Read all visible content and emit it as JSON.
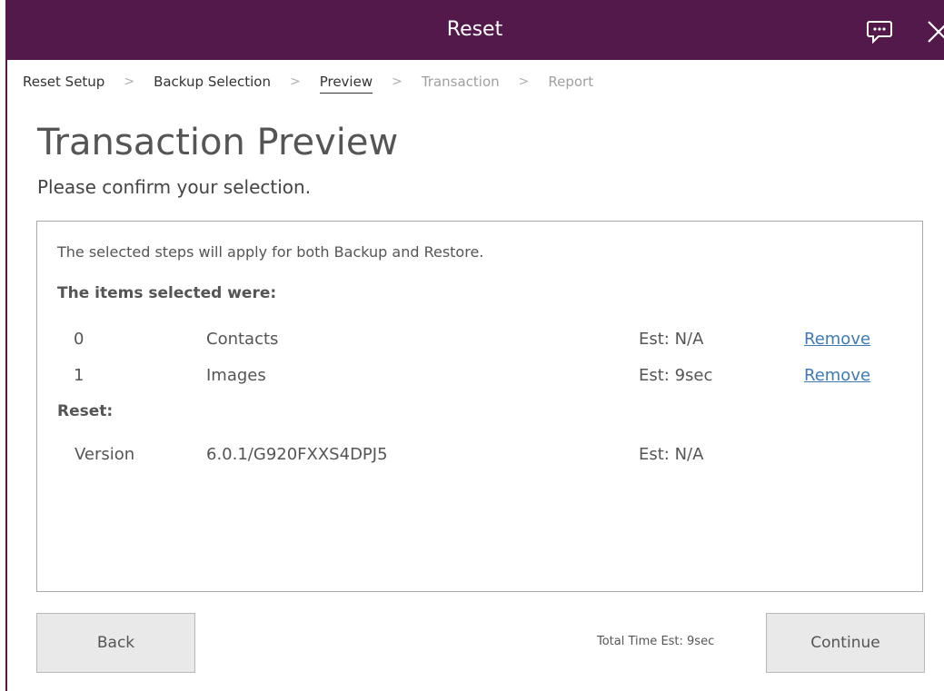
{
  "window": {
    "title": "Reset",
    "chat_icon": "chat-bubble-icon",
    "close_icon": "close-icon",
    "accent_color": "#52194a"
  },
  "breadcrumb": {
    "items": [
      {
        "label": "Reset Setup",
        "state": "completed"
      },
      {
        "label": "Backup Selection",
        "state": "completed"
      },
      {
        "label": "Preview",
        "state": "current"
      },
      {
        "label": "Transaction",
        "state": "disabled"
      },
      {
        "label": "Report",
        "state": "disabled"
      }
    ],
    "separator": ">"
  },
  "page": {
    "title": "Transaction Preview",
    "subtitle": "Please confirm your selection."
  },
  "panel": {
    "note": "The selected steps will apply for both Backup and Restore.",
    "items_heading": "The items selected were:",
    "items": [
      {
        "index": "0",
        "name": "Contacts",
        "estimate": "Est: N/A",
        "action": "Remove"
      },
      {
        "index": "1",
        "name": "Images",
        "estimate": "Est: 9sec",
        "action": "Remove"
      }
    ],
    "reset_heading": "Reset:",
    "reset": {
      "label": "Version",
      "value": "6.0.1/G920FXXS4DPJ5",
      "estimate": "Est: N/A"
    }
  },
  "footer": {
    "back_label": "Back",
    "total_estimate": "Total Time Est: 9sec",
    "continue_label": "Continue"
  }
}
